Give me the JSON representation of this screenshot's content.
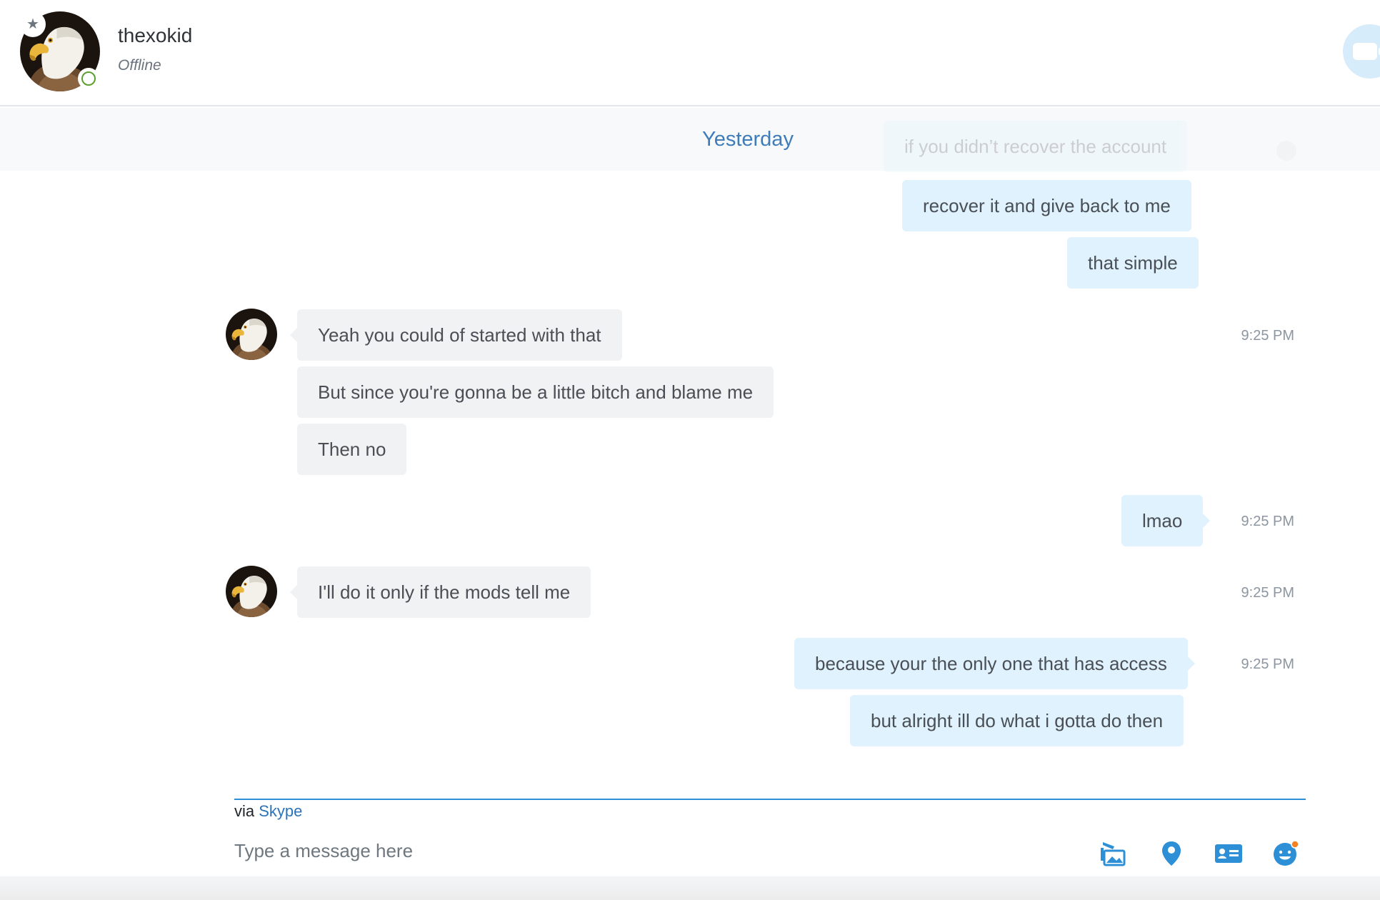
{
  "colors": {
    "accent": "#2d8fd5",
    "outgoing_bubble": "#dff2fd",
    "incoming_bubble": "#f1f2f4",
    "online_ring": "#5aa02c",
    "timestamp": "#8c96a0"
  },
  "header": {
    "contact_name": "thexokid",
    "status": "Offline",
    "avatar_icon": "bald-eagle-avatar",
    "favorite_icon": "star-icon",
    "video_icon": "video-camera-icon"
  },
  "chat": {
    "date_divider": "Yesterday",
    "messages": [
      {
        "direction": "out",
        "text": "if you didn’t recover the account",
        "time": ""
      },
      {
        "direction": "out",
        "text": "recover it and give back to me",
        "time": ""
      },
      {
        "direction": "out",
        "text": "that simple",
        "time": ""
      },
      {
        "direction": "in",
        "text": "Yeah you could of started with that",
        "time": "9:25 PM"
      },
      {
        "direction": "in",
        "text": "But since you're gonna be a little bitch and blame me",
        "time": ""
      },
      {
        "direction": "in",
        "text": "Then no",
        "time": ""
      },
      {
        "direction": "out",
        "text": "lmao",
        "time": "9:25 PM"
      },
      {
        "direction": "in",
        "text": "I'll do it only if the mods tell me",
        "time": "9:25 PM"
      },
      {
        "direction": "out",
        "text": "because your the only one that has access",
        "time": "9:25 PM"
      },
      {
        "direction": "out",
        "text": "but alright ill do what i gotta do then",
        "time": ""
      }
    ]
  },
  "compose": {
    "via_prefix": "via",
    "via_service": "Skype",
    "placeholder": "Type a message here",
    "value": "",
    "tools": [
      "media-gallery-icon",
      "location-pin-icon",
      "contact-card-icon",
      "emoticon-icon"
    ]
  }
}
